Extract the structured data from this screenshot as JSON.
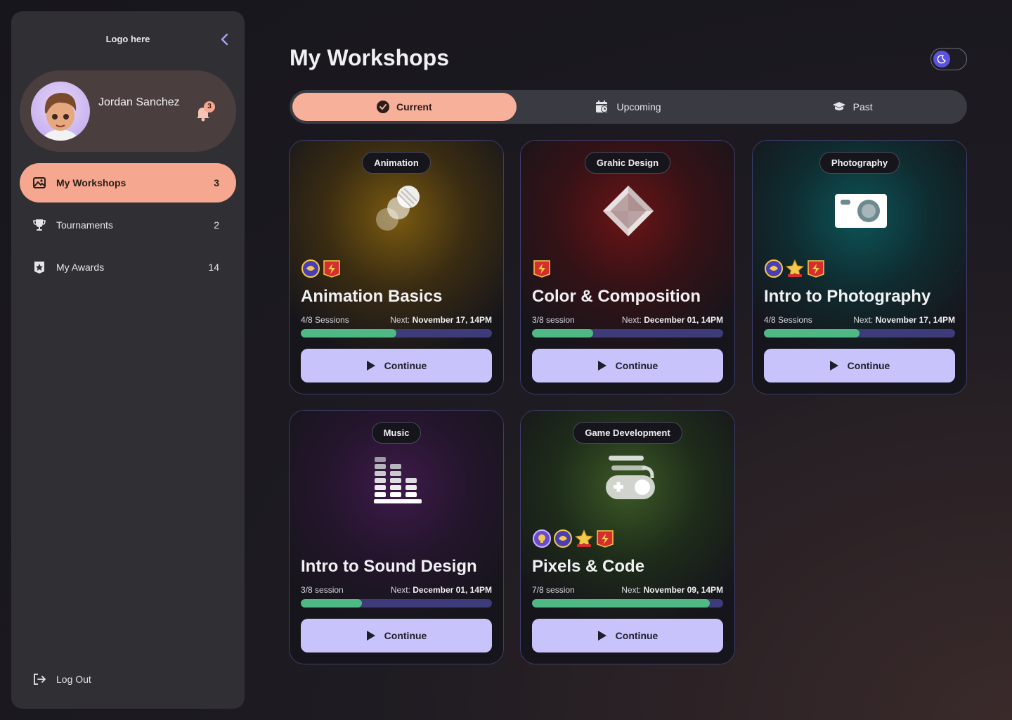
{
  "sidebar": {
    "logo": "Logo here",
    "user": {
      "name": "Jordan Sanchez",
      "notifications": "3"
    },
    "nav": [
      {
        "label": "My Workshops",
        "count": "3",
        "icon": "image-icon",
        "active": true
      },
      {
        "label": "Tournaments",
        "count": "2",
        "icon": "trophy-icon",
        "active": false
      },
      {
        "label": "My Awards",
        "count": "14",
        "icon": "award-icon",
        "active": false
      }
    ],
    "logout": "Log Out"
  },
  "header": {
    "title": "My Workshops",
    "theme": "dark"
  },
  "tabs": [
    {
      "label": "Current",
      "icon": "check-circle-icon",
      "active": true
    },
    {
      "label": "Upcoming",
      "icon": "calendar-icon",
      "active": false
    },
    {
      "label": "Past",
      "icon": "graduation-cap-icon",
      "active": false
    }
  ],
  "workshops": [
    {
      "category": "Animation",
      "title": "Animation Basics",
      "sessions": "4/8 Sessions",
      "next_label": "Next:",
      "next": "November 17, 14PM",
      "progress": 0.5,
      "button": "Continue",
      "badges": [
        "team-badge",
        "speed-badge"
      ],
      "accent": "#c98a1a"
    },
    {
      "category": "Grahic Design",
      "title": "Color & Composition",
      "sessions": "3/8 session",
      "next_label": "Next:",
      "next": "December 01, 14PM",
      "progress": 0.32,
      "button": "Continue",
      "badges": [
        "speed-badge"
      ],
      "accent": "#8a1f22"
    },
    {
      "category": "Photography",
      "title": "Intro to Photography",
      "sessions": "4/8 Sessions",
      "next_label": "Next:",
      "next": "November 17, 14PM",
      "progress": 0.5,
      "button": "Continue",
      "badges": [
        "team-badge",
        "star-badge",
        "speed-badge"
      ],
      "accent": "#0f6a6e"
    },
    {
      "category": "Music",
      "title": "Intro to Sound Design",
      "sessions": "3/8 session",
      "next_label": "Next:",
      "next": "December 01, 14PM",
      "progress": 0.32,
      "button": "Continue",
      "badges": [],
      "accent": "#5a2a6a"
    },
    {
      "category": "Game Development",
      "title": "Pixels & Code",
      "sessions": "7/8 session",
      "next_label": "Next:",
      "next": "November 09, 14PM",
      "progress": 0.93,
      "button": "Continue",
      "badges": [
        "idea-badge",
        "team-badge",
        "star-badge",
        "speed-badge"
      ],
      "accent": "#3f6a2a"
    }
  ]
}
